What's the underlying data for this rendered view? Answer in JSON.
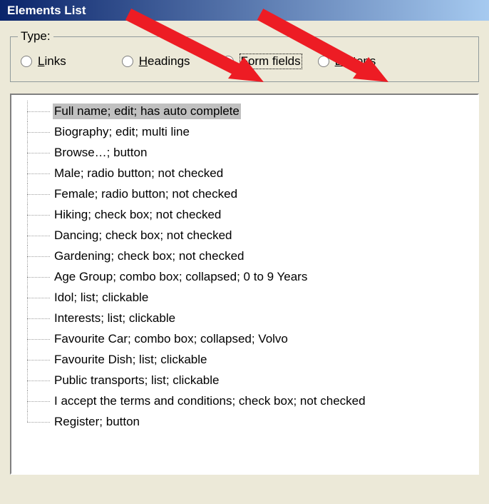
{
  "title": "Elements List",
  "type_group": {
    "legend": "Type:",
    "options": [
      {
        "label_pre": "",
        "hotkey": "L",
        "label_post": "inks",
        "checked": false
      },
      {
        "label_pre": "",
        "hotkey": "H",
        "label_post": "eadings",
        "checked": false
      },
      {
        "label_pre": "",
        "hotkey": "F",
        "label_post": "orm fields",
        "checked": true,
        "focused": true
      },
      {
        "label_pre": "",
        "hotkey": "B",
        "label_post": "uttons",
        "checked": false
      }
    ]
  },
  "tree_items": [
    "Full name; edit; has auto complete",
    "Biography; edit; multi line",
    "Browse…; button",
    "Male; radio button; not checked",
    "Female; radio button; not checked",
    "Hiking; check box; not checked",
    "Dancing; check box; not checked",
    "Gardening; check box; not checked",
    "Age Group; combo box; collapsed; 0 to 9 Years",
    "Idol; list; clickable",
    "Interests; list; clickable",
    "Favourite Car; combo box; collapsed; Volvo",
    "Favourite Dish; list; clickable",
    "Public transports; list; clickable",
    "I accept the terms and conditions; check box; not checked",
    "Register; button"
  ],
  "selected_index": 0,
  "annotations": {
    "arrow_color": "#ed1c24"
  }
}
